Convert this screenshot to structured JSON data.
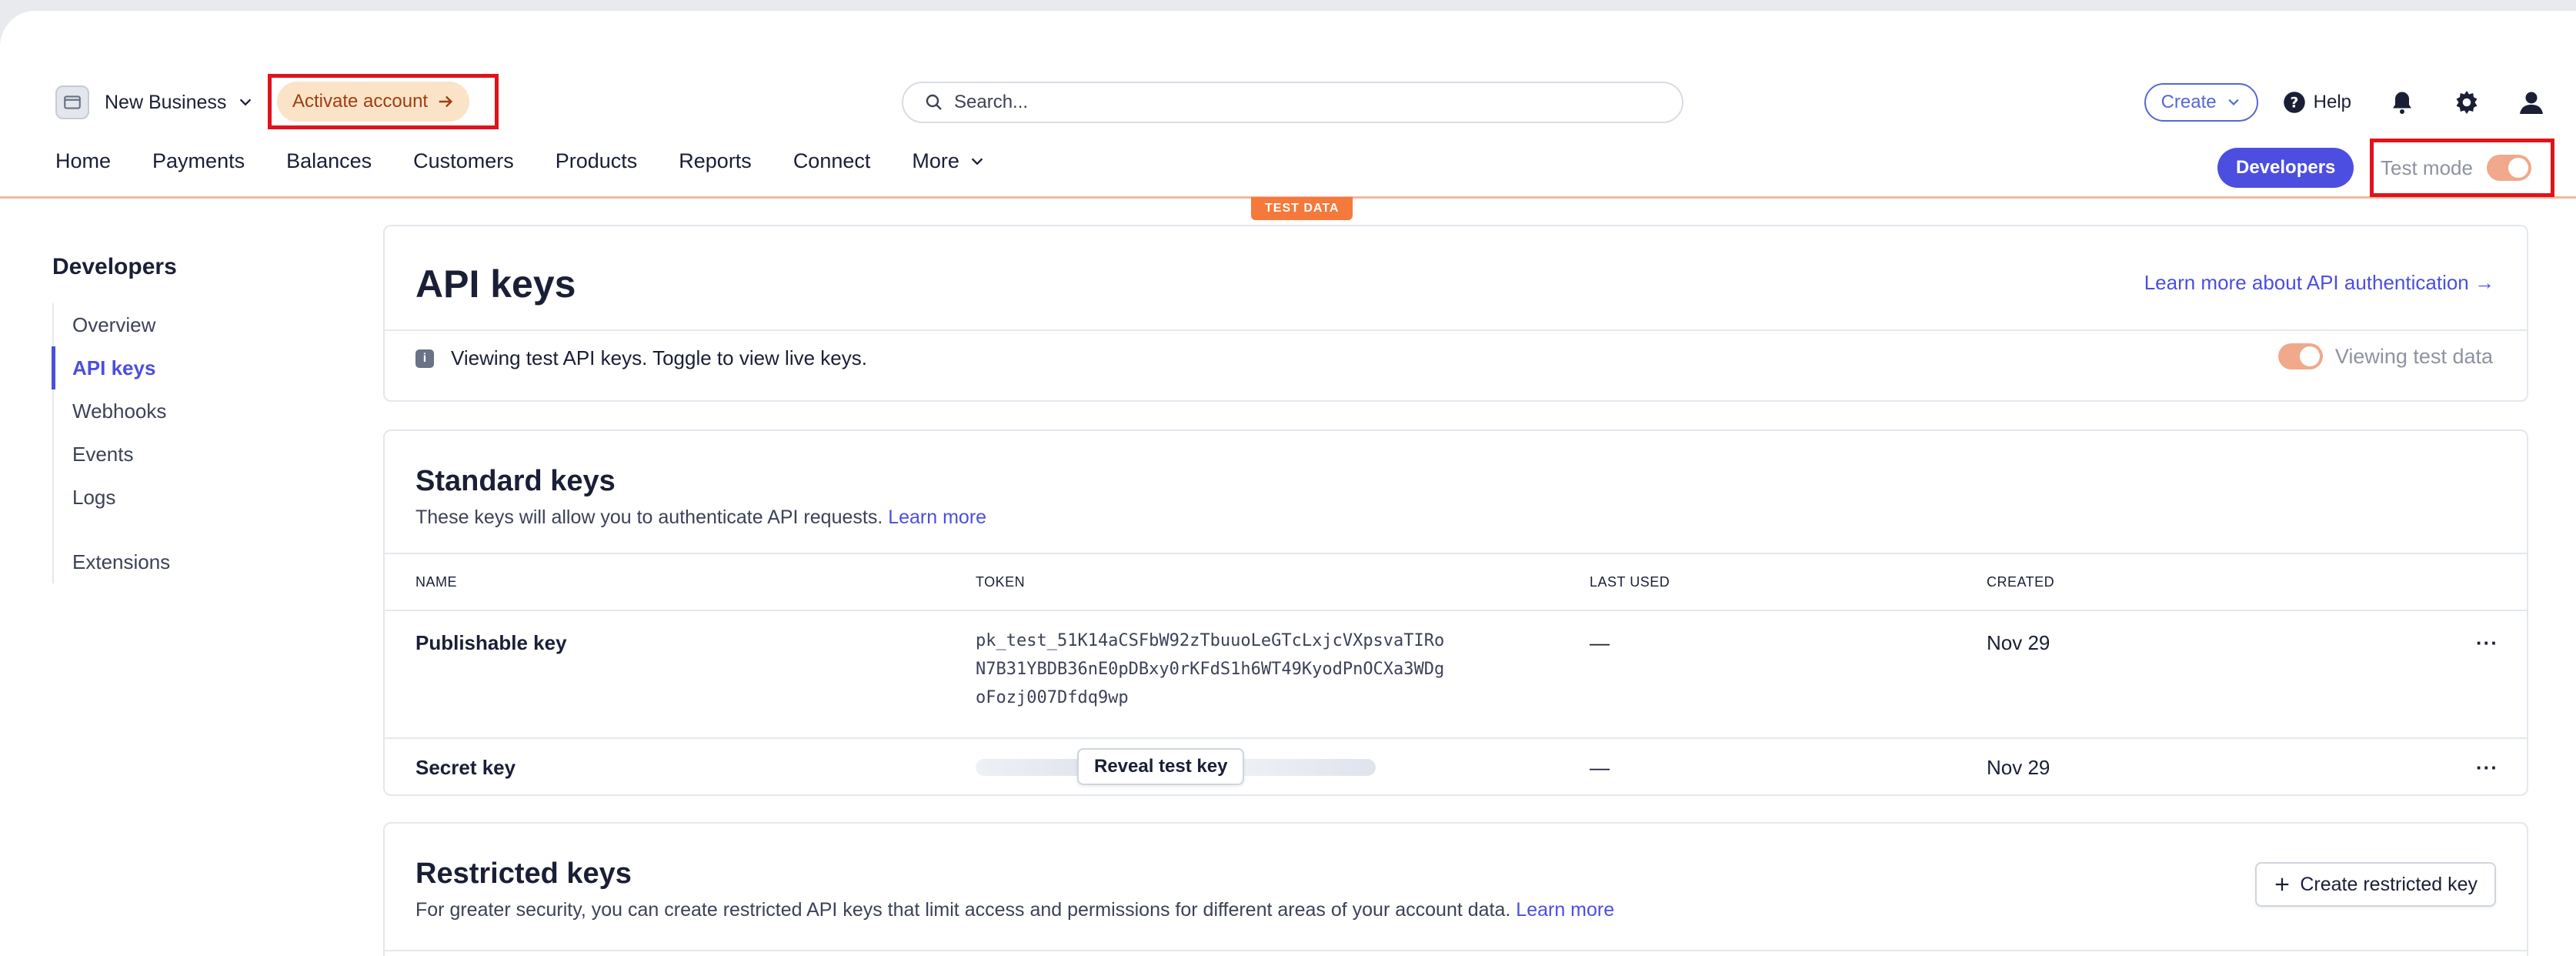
{
  "topbar": {
    "business_name": "New Business",
    "activate_label": "Activate account",
    "search_placeholder": "Search...",
    "create_label": "Create",
    "help_label": "Help"
  },
  "nav": {
    "items": [
      "Home",
      "Payments",
      "Balances",
      "Customers",
      "Products",
      "Reports",
      "Connect",
      "More"
    ],
    "developers_label": "Developers",
    "test_mode_label": "Test mode",
    "test_data_tag": "TEST DATA"
  },
  "sidebar": {
    "title": "Developers",
    "items": [
      "Overview",
      "API keys",
      "Webhooks",
      "Events",
      "Logs",
      "Extensions"
    ],
    "active": "API keys"
  },
  "api_keys_panel": {
    "title": "API keys",
    "learn_more": "Learn more about API authentication →",
    "info_text": "Viewing test API keys. Toggle to view live keys.",
    "viewing_label": "Viewing test data"
  },
  "standard_keys": {
    "title": "Standard keys",
    "desc": "These keys will allow you to authenticate API requests.",
    "learn_more": "Learn more",
    "columns": [
      "NAME",
      "TOKEN",
      "LAST USED",
      "CREATED"
    ],
    "rows": [
      {
        "name": "Publishable key",
        "token_lines": [
          "pk_test_51K14aCSFbW92zTbuuoLeGTcLxjcVXpsvaTIRo",
          "N7B31YBDB36nE0pDBxy0rKFdS1h6WT49KyodPnOCXa3WDg",
          "oFozj007Dfdq9wp"
        ],
        "last_used": "—",
        "created": "Nov 29"
      },
      {
        "name": "Secret key",
        "reveal_label": "Reveal test key",
        "last_used": "—",
        "created": "Nov 29"
      }
    ]
  },
  "restricted_keys": {
    "title": "Restricted keys",
    "desc": "For greater security, you can create restricted API keys that limit access and permissions for different areas of your account data.",
    "learn_more": "Learn more",
    "create_label": "Create restricted key"
  },
  "colors": {
    "accent": "#4c4ee0",
    "test_orange": "#f5793b",
    "highlight_red": "#e0131c"
  }
}
